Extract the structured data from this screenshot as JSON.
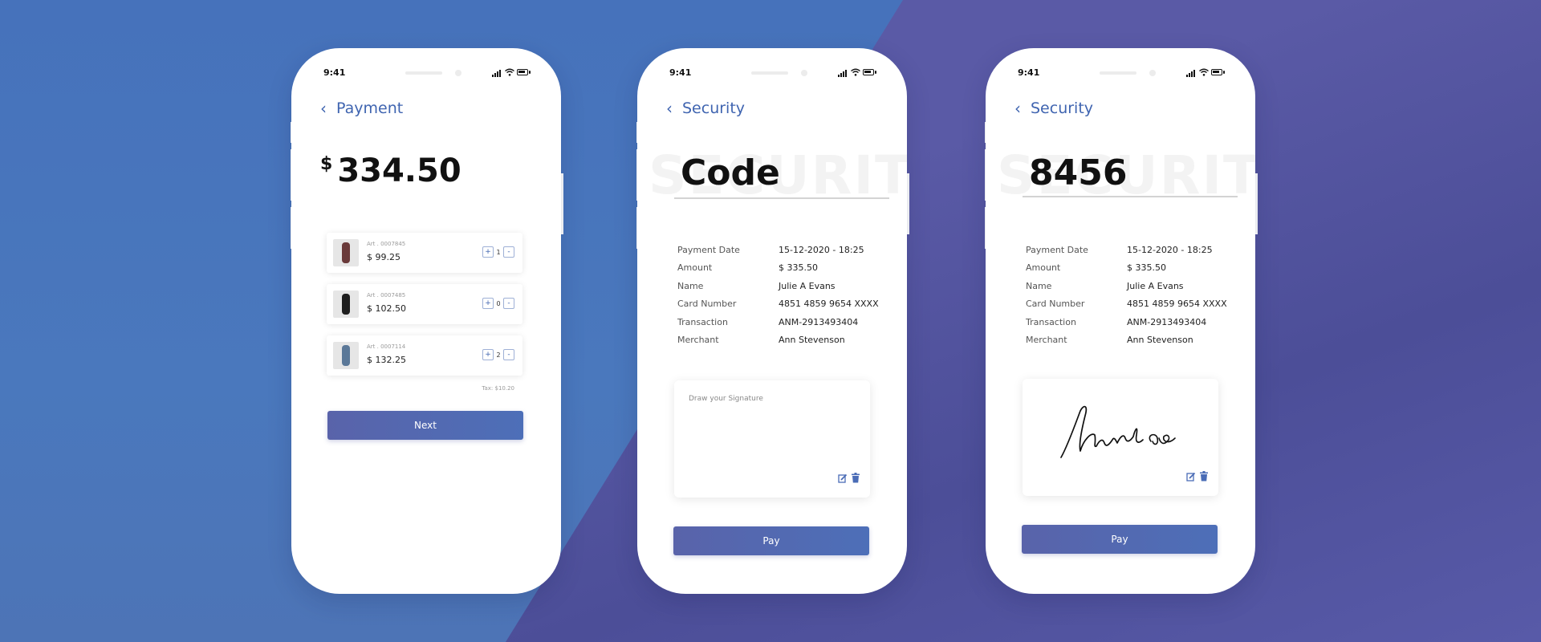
{
  "status_time": "9:41",
  "colors": {
    "accent": "#3f64b0",
    "button_start": "#5963aa",
    "button_end": "#4d6fb8"
  },
  "screen1": {
    "back_icon": "chevron-left-icon",
    "title": "Payment",
    "currency": "$",
    "amount": "334.50",
    "items": [
      {
        "art": "Art . 0007845",
        "price": "$ 99.25",
        "qty": "1",
        "plus": "+",
        "minus": "-"
      },
      {
        "art": "Art . 0007485",
        "price": "$ 102.50",
        "qty": "0",
        "plus": "+",
        "minus": "-"
      },
      {
        "art": "Art . 0007114",
        "price": "$ 132.25",
        "qty": "2",
        "plus": "+",
        "minus": "-"
      }
    ],
    "tax": "Tax: $10.20",
    "button": "Next"
  },
  "screen2": {
    "title": "Security",
    "watermark": "SECURITY",
    "code": "Code",
    "details": [
      {
        "label": "Payment Date",
        "value": "15-12-2020 - 18:25"
      },
      {
        "label": "Amount",
        "value": "$ 335.50"
      },
      {
        "label": "Name",
        "value": "Julie A Evans"
      },
      {
        "label": "Card Number",
        "value": "4851 4859 9654 XXXX"
      },
      {
        "label": "Transaction",
        "value": "ANM-2913493404"
      },
      {
        "label": "Merchant",
        "value": "Ann Stevenson"
      }
    ],
    "signature_placeholder": "Draw your Signature",
    "button": "Pay"
  },
  "screen3": {
    "title": "Security",
    "watermark": "SECURITY",
    "code": "8456",
    "details": [
      {
        "label": "Payment Date",
        "value": "15-12-2020 - 18:25"
      },
      {
        "label": "Amount",
        "value": "$ 335.50"
      },
      {
        "label": "Name",
        "value": "Julie A Evans"
      },
      {
        "label": "Card Number",
        "value": "4851 4859 9654 XXXX"
      },
      {
        "label": "Transaction",
        "value": "ANM-2913493404"
      },
      {
        "label": "Merchant",
        "value": "Ann Stevenson"
      }
    ],
    "button": "Pay"
  }
}
